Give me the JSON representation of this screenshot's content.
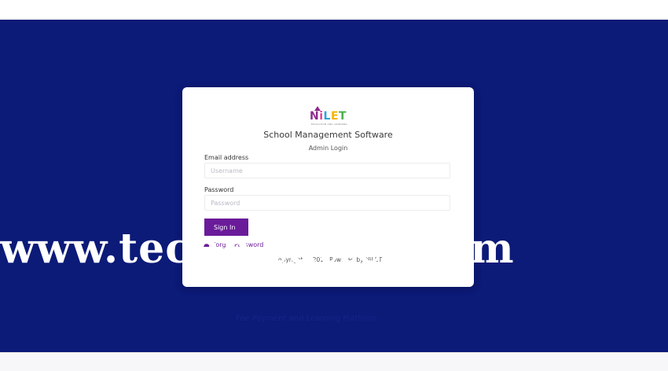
{
  "logo": {
    "text_parts": [
      "N",
      "i",
      "L",
      "E",
      "T"
    ],
    "tagline": "EDUCATION AND LEARNING"
  },
  "card": {
    "app_title": "School Management Software",
    "subtitle": "Admin Login",
    "email": {
      "label": "Email address",
      "placeholder": "Username",
      "value": ""
    },
    "password": {
      "label": "Password",
      "placeholder": "Password",
      "value": ""
    },
    "signin_label": "Sign In",
    "forgot_label": "Forgot Password",
    "copyright": "Copyright © 2018 Powered by NiLET"
  },
  "footer_text": "Fee Payment and Learning Platform",
  "watermark": "www.techn   tutter.com",
  "colors": {
    "background": "#0c1a78",
    "accent": "#6a1b9a",
    "card": "#ffffff"
  }
}
